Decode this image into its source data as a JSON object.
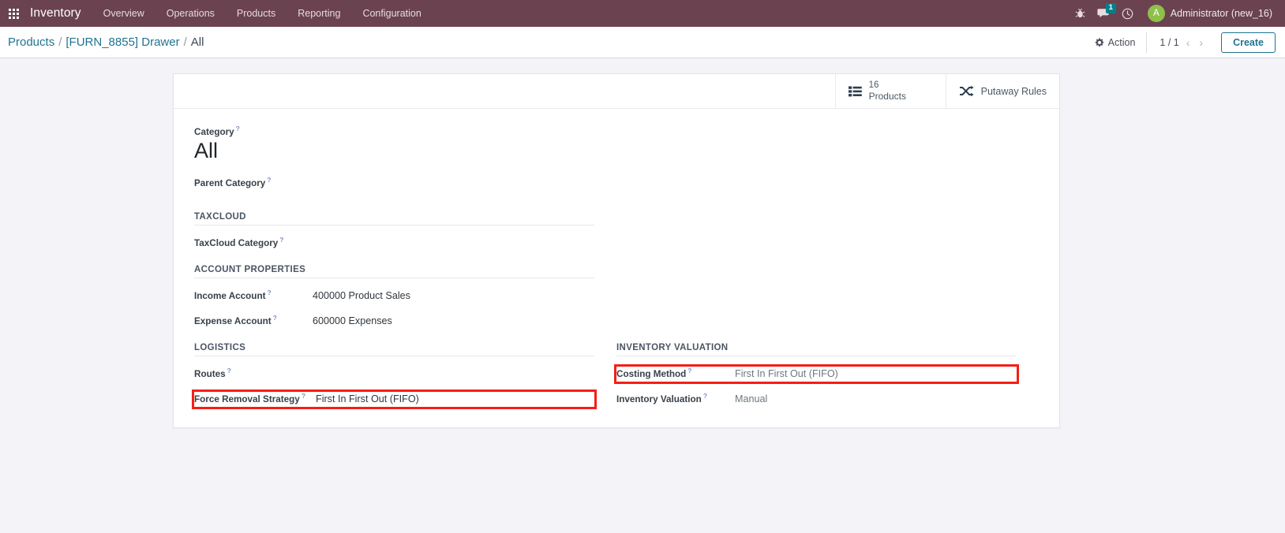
{
  "navbar": {
    "apps_icon": "apps-grid-icon",
    "brand": "Inventory",
    "menu": [
      {
        "label": "Overview"
      },
      {
        "label": "Operations"
      },
      {
        "label": "Products"
      },
      {
        "label": "Reporting"
      },
      {
        "label": "Configuration"
      }
    ],
    "sys_icons": [
      {
        "name": "bug-icon",
        "glyph": "☣"
      },
      {
        "name": "messages-icon",
        "glyph": "●",
        "badge": "1"
      },
      {
        "name": "activity-clock-icon",
        "glyph": "◷"
      }
    ],
    "badge": "1",
    "user": {
      "initial": "A",
      "name": "Administrator (new_16)"
    },
    "bg_color": "#6b4250",
    "badge_color": "#00818a",
    "avatar_color": "#8fc04a"
  },
  "control_panel": {
    "breadcrumb": [
      {
        "label": "Products",
        "active": false
      },
      {
        "label": "[FURN_8855] Drawer",
        "active": false
      },
      {
        "label": "All",
        "active": true
      }
    ],
    "separator": "/",
    "action_label": "Action",
    "action_icon": "gear-icon",
    "pager": {
      "text": "1 / 1",
      "prev_icon": "chevron-left-icon",
      "next_icon": "chevron-right-icon"
    },
    "create_label": "Create",
    "link_color": "#1f7491"
  },
  "stat_buttons": [
    {
      "icon": "list-icon",
      "value": "16",
      "label": "Products"
    },
    {
      "icon": "shuffle-icon",
      "label": "Putaway Rules"
    }
  ],
  "form": {
    "title": {
      "label": "Category",
      "help": "?",
      "value": "All"
    },
    "parent_category": {
      "label": "Parent Category",
      "help": "?",
      "value": ""
    },
    "sections": {
      "taxcloud": {
        "title": "TAXCLOUD",
        "fields": [
          {
            "label": "TaxCloud Category",
            "help": "?",
            "value": ""
          }
        ]
      },
      "account_properties": {
        "title": "ACCOUNT PROPERTIES",
        "fields": [
          {
            "label": "Income Account",
            "help": "?",
            "value": "400000 Product Sales"
          },
          {
            "label": "Expense Account",
            "help": "?",
            "value": "600000 Expenses"
          }
        ]
      },
      "logistics": {
        "title": "LOGISTICS",
        "fields": [
          {
            "label": "Routes",
            "help": "?",
            "value": ""
          },
          {
            "label": "Force Removal Strategy",
            "help": "?",
            "value": "First In First Out (FIFO)",
            "highlighted": true
          }
        ]
      },
      "inventory_valuation": {
        "title": "INVENTORY VALUATION",
        "fields": [
          {
            "label": "Costing Method",
            "help": "?",
            "value": "First In First Out (FIFO)",
            "highlighted": true
          },
          {
            "label": "Inventory Valuation",
            "help": "?",
            "value": "Manual"
          }
        ]
      }
    }
  },
  "highlight_color": "#f61e14"
}
